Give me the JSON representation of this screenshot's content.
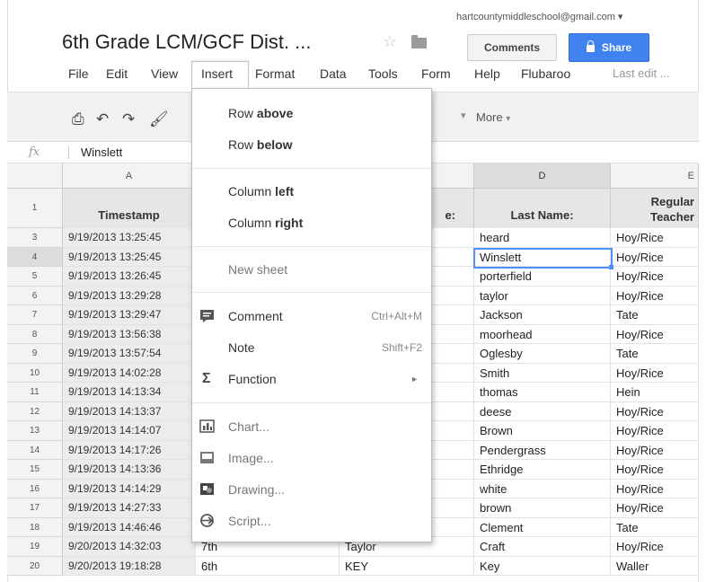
{
  "header": {
    "account": "hartcountymiddleschool@gmail.com ▾",
    "title": "6th Grade LCM/GCF Dist. ...",
    "comments_label": "Comments",
    "share_label": "Share"
  },
  "menubar": {
    "items": [
      "File",
      "Edit",
      "View",
      "Insert",
      "Format",
      "Data",
      "Tools",
      "Form",
      "Help",
      "Flubaroo"
    ],
    "last_edit": "Last edit ..."
  },
  "toolbar": {
    "more_label": "More",
    "caret": "▾",
    "more_caret": "▾"
  },
  "formula_bar": {
    "fx": "fx",
    "value": "Winslett"
  },
  "columns": {
    "a": "A",
    "d": "D",
    "e": "E"
  },
  "header_row": {
    "number": "1",
    "timestamp": "Timestamp",
    "partial_c": "e:",
    "last_name": "Last Name:",
    "regular_teacher": "Regular Teacher"
  },
  "rows": [
    {
      "num": "3",
      "ts": "9/19/2013 13:25:45",
      "b": "",
      "c": "",
      "last": "heard",
      "teacher": "Hoy/Rice"
    },
    {
      "num": "4",
      "ts": "9/19/2013 13:25:45",
      "b": "",
      "c": "",
      "last": "Winslett",
      "teacher": "Hoy/Rice"
    },
    {
      "num": "5",
      "ts": "9/19/2013 13:26:45",
      "b": "",
      "c": "",
      "last": "porterfield",
      "teacher": "Hoy/Rice"
    },
    {
      "num": "6",
      "ts": "9/19/2013 13:29:28",
      "b": "",
      "c": "",
      "last": "taylor",
      "teacher": "Hoy/Rice"
    },
    {
      "num": "7",
      "ts": "9/19/2013 13:29:47",
      "b": "",
      "c": "",
      "last": "Jackson",
      "teacher": "Tate"
    },
    {
      "num": "8",
      "ts": "9/19/2013 13:56:38",
      "b": "",
      "c": "",
      "last": "moorhead",
      "teacher": "Hoy/Rice"
    },
    {
      "num": "9",
      "ts": "9/19/2013 13:57:54",
      "b": "",
      "c": "",
      "last": "Oglesby",
      "teacher": "Tate"
    },
    {
      "num": "10",
      "ts": "9/19/2013 14:02:28",
      "b": "",
      "c": "",
      "last": "Smith",
      "teacher": "Hoy/Rice"
    },
    {
      "num": "11",
      "ts": "9/19/2013 14:13:34",
      "b": "",
      "c": "",
      "last": "thomas",
      "teacher": "Hein"
    },
    {
      "num": "12",
      "ts": "9/19/2013 14:13:37",
      "b": "",
      "c": "",
      "last": "deese",
      "teacher": "Hoy/Rice"
    },
    {
      "num": "13",
      "ts": "9/19/2013 14:14:07",
      "b": "",
      "c": "",
      "last": "Brown",
      "teacher": "Hoy/Rice"
    },
    {
      "num": "14",
      "ts": "9/19/2013 14:17:26",
      "b": "",
      "c": "",
      "last": "Pendergrass",
      "teacher": "Hoy/Rice"
    },
    {
      "num": "15",
      "ts": "9/19/2013 14:13:36",
      "b": "",
      "c": "",
      "last": "Ethridge",
      "teacher": "Hoy/Rice"
    },
    {
      "num": "16",
      "ts": "9/19/2013 14:14:29",
      "b": "",
      "c": "",
      "last": "white",
      "teacher": "Hoy/Rice"
    },
    {
      "num": "17",
      "ts": "9/19/2013 14:27:33",
      "b": "",
      "c": "",
      "last": "brown",
      "teacher": "Hoy/Rice"
    },
    {
      "num": "18",
      "ts": "9/19/2013 14:46:46",
      "b": "",
      "c": "",
      "last": "Clement",
      "teacher": "Tate"
    },
    {
      "num": "19",
      "ts": "9/20/2013 14:32:03",
      "b": "7th",
      "c": "Taylor",
      "last": "Craft",
      "teacher": "Hoy/Rice"
    },
    {
      "num": "20",
      "ts": "9/20/2013 19:18:28",
      "b": "6th",
      "c": "KEY",
      "last": "Key",
      "teacher": "Waller"
    }
  ],
  "insert_menu": {
    "row_above_pre": "Row ",
    "row_above_bold": "above",
    "row_below_pre": "Row ",
    "row_below_bold": "below",
    "col_left_pre": "Column ",
    "col_left_bold": "left",
    "col_right_pre": "Column ",
    "col_right_bold": "right",
    "new_sheet": "New sheet",
    "comment": "Comment",
    "comment_shortcut": "Ctrl+Alt+M",
    "note": "Note",
    "note_shortcut": "Shift+F2",
    "function": "Function",
    "function_arrow": "►",
    "chart": "Chart...",
    "image": "Image...",
    "drawing": "Drawing...",
    "script": "Script..."
  },
  "colors": {
    "share_blue": "#3f82f0",
    "selection_blue": "#4d90fe"
  }
}
